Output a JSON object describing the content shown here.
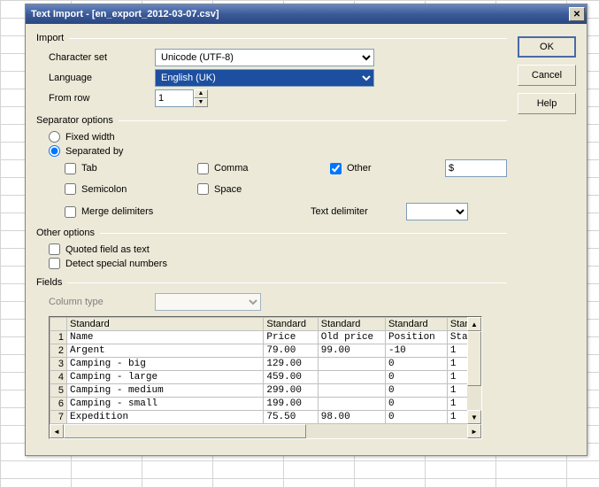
{
  "title": "Text Import - [en_export_2012-03-07.csv]",
  "buttons": {
    "ok": "OK",
    "cancel": "Cancel",
    "help": "Help"
  },
  "import": {
    "legend": "Import",
    "charset_label": "Character set",
    "charset_value": "Unicode (UTF-8)",
    "language_label": "Language",
    "language_value": "English (UK)",
    "fromrow_label": "From row",
    "fromrow_value": "1"
  },
  "separator": {
    "legend": "Separator options",
    "fixed_label": "Fixed width",
    "separated_label": "Separated by",
    "tab": "Tab",
    "comma": "Comma",
    "other": "Other",
    "other_value": "$",
    "semicolon": "Semicolon",
    "space": "Space",
    "merge": "Merge delimiters",
    "textdelim_label": "Text delimiter",
    "textdelim_value": ""
  },
  "other": {
    "legend": "Other options",
    "quoted": "Quoted field as text",
    "detect": "Detect special numbers"
  },
  "fields": {
    "legend": "Fields",
    "coltype_label": "Column type",
    "coltype_value": "",
    "headers": [
      "Standard",
      "Standard",
      "Standard",
      "Standard",
      "Stan"
    ],
    "rows": [
      {
        "n": "1",
        "c": [
          "Name",
          "Price",
          "Old price",
          "Position",
          "Sta"
        ]
      },
      {
        "n": "2",
        "c": [
          "Argent",
          "79.00",
          "99.00",
          "-10",
          "1"
        ]
      },
      {
        "n": "3",
        "c": [
          "Camping - big",
          "129.00",
          "",
          "0",
          "1"
        ]
      },
      {
        "n": "4",
        "c": [
          "Camping - large",
          "459.00",
          "",
          "0",
          "1"
        ]
      },
      {
        "n": "5",
        "c": [
          "Camping - medium",
          "299.00",
          "",
          "0",
          "1"
        ]
      },
      {
        "n": "6",
        "c": [
          "Camping - small",
          "199.00",
          "",
          "0",
          "1"
        ]
      },
      {
        "n": "7",
        "c": [
          "Expedition",
          "75.50",
          "98.00",
          "0",
          "1"
        ]
      }
    ]
  }
}
